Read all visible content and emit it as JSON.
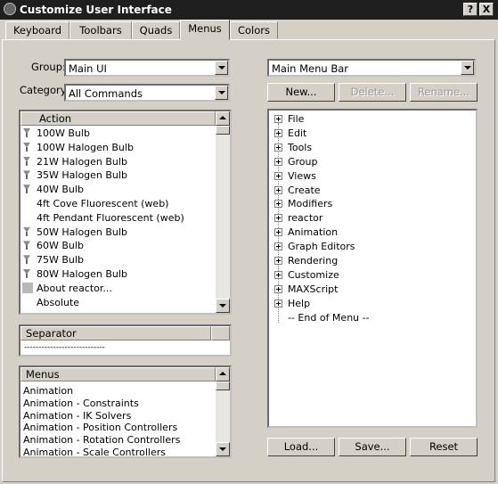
{
  "window": {
    "title": "Customize User Interface",
    "help_label": "?",
    "close_label": "X"
  },
  "tabs": [
    {
      "label": "Keyboard",
      "active": false
    },
    {
      "label": "Toolbars",
      "active": false
    },
    {
      "label": "Quads",
      "active": false
    },
    {
      "label": "Menus",
      "active": true
    },
    {
      "label": "Colors",
      "active": false
    }
  ],
  "left": {
    "group_label": "Group:",
    "group_value": "Main UI",
    "category_label": "Category:",
    "category_value": "All Commands",
    "action_header": "Action",
    "actions": [
      {
        "label": "100W Bulb",
        "icon": "bulb-icon"
      },
      {
        "label": "100W Halogen Bulb",
        "icon": "bulb-icon"
      },
      {
        "label": "21W Halogen Bulb",
        "icon": "bulb-icon"
      },
      {
        "label": "35W Halogen Bulb",
        "icon": "bulb-icon"
      },
      {
        "label": "40W Bulb",
        "icon": "bulb-icon"
      },
      {
        "label": "4ft Cove Fluorescent (web)",
        "icon": ""
      },
      {
        "label": "4ft Pendant Fluorescent (web)",
        "icon": ""
      },
      {
        "label": "50W Halogen Bulb",
        "icon": "bulb-icon"
      },
      {
        "label": "60W Bulb",
        "icon": "bulb-icon"
      },
      {
        "label": "75W Bulb",
        "icon": "bulb-icon"
      },
      {
        "label": "80W Halogen Bulb",
        "icon": "bulb-icon"
      },
      {
        "label": "About reactor...",
        "icon": "help-icon"
      },
      {
        "label": "Absolute",
        "icon": ""
      }
    ],
    "separator_header": "Separator",
    "separator_item": "----------------------------",
    "menus_header": "Menus",
    "menus": [
      "Animation",
      "Animation - Constraints",
      "Animation - IK Solvers",
      "Animation - Position Controllers",
      "Animation - Rotation Controllers",
      "Animation - Scale Controllers"
    ]
  },
  "right": {
    "menu_value": "Main Menu Bar",
    "new_label": "New...",
    "delete_label": "Delete...",
    "rename_label": "Rename...",
    "tree": [
      "File",
      "Edit",
      "Tools",
      "Group",
      "Views",
      "Create",
      "Modifiers",
      "reactor",
      "Animation",
      "Graph Editors",
      "Rendering",
      "Customize",
      "MAXScript",
      "Help"
    ],
    "end_label": "-- End of Menu --",
    "load_label": "Load...",
    "save_label": "Save...",
    "reset_label": "Reset"
  },
  "colors": {
    "titlebar": "#1f1f1f",
    "face": "#d4d0c8"
  }
}
